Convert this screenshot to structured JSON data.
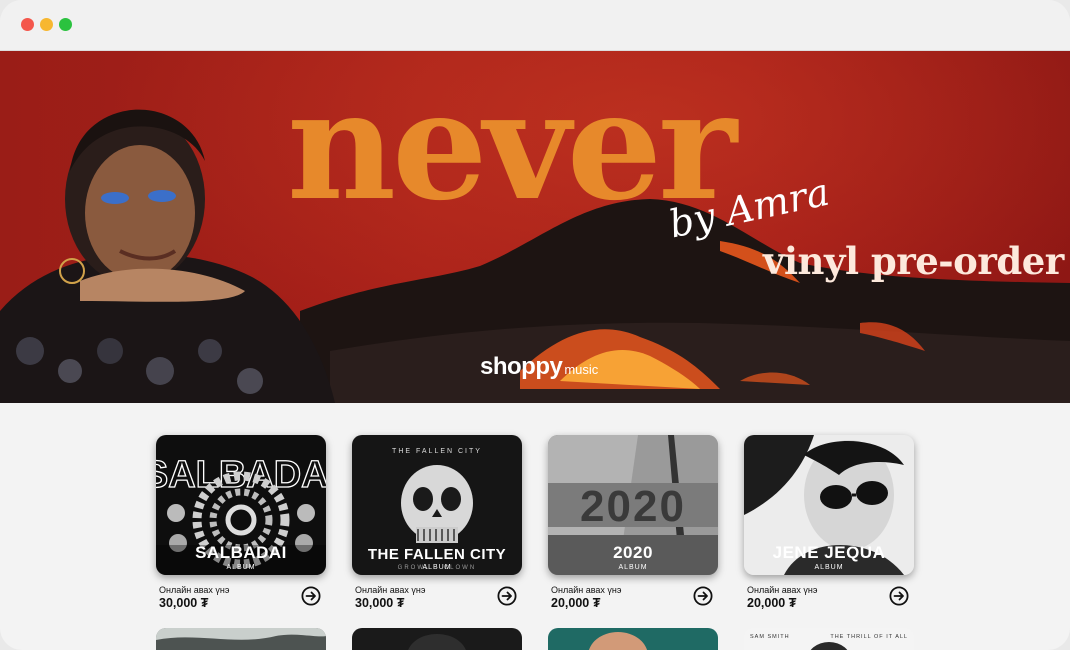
{
  "window": {
    "controls": [
      "close-icon",
      "minimize-icon",
      "maximize-icon"
    ]
  },
  "hero": {
    "title": "never",
    "by_line": "by Amra",
    "subtitle": "vinyl pre-order",
    "logo_main": "shoppy",
    "logo_sub": "music",
    "colors": {
      "background": "#a31c18",
      "title": "#e7892b",
      "subtitle": "#fde9dc"
    }
  },
  "products": [
    {
      "cover_text": "SALBADAI",
      "title": "SALBADAI",
      "type": "ALBUM",
      "price_label": "Онлайн авах үнэ",
      "price": "30,000 ₮"
    },
    {
      "cover_text": "THE FALLEN CITY",
      "cover_sub": "GROWL",
      "cover_sub2": "CLOWN",
      "title": "THE FALLEN CITY",
      "type": "ALBUM",
      "price_label": "Онлайн авах үнэ",
      "price": "30,000 ₮"
    },
    {
      "cover_text": "2020",
      "title": "2020",
      "type": "ALBUM",
      "price_label": "Онлайн авах үнэ",
      "price": "20,000 ₮"
    },
    {
      "title": "JENE JEQUA",
      "type": "ALBUM",
      "price_label": "Онлайн авах үнэ",
      "price": "20,000 ₮"
    }
  ],
  "row2": [
    {
      "top_left": "",
      "top_right": ""
    },
    {
      "top_left": "",
      "top_right": ""
    },
    {
      "top_left": "",
      "top_right": ""
    },
    {
      "top_left": "SAM SMITH",
      "top_right": "THE THRILL OF IT ALL"
    }
  ]
}
